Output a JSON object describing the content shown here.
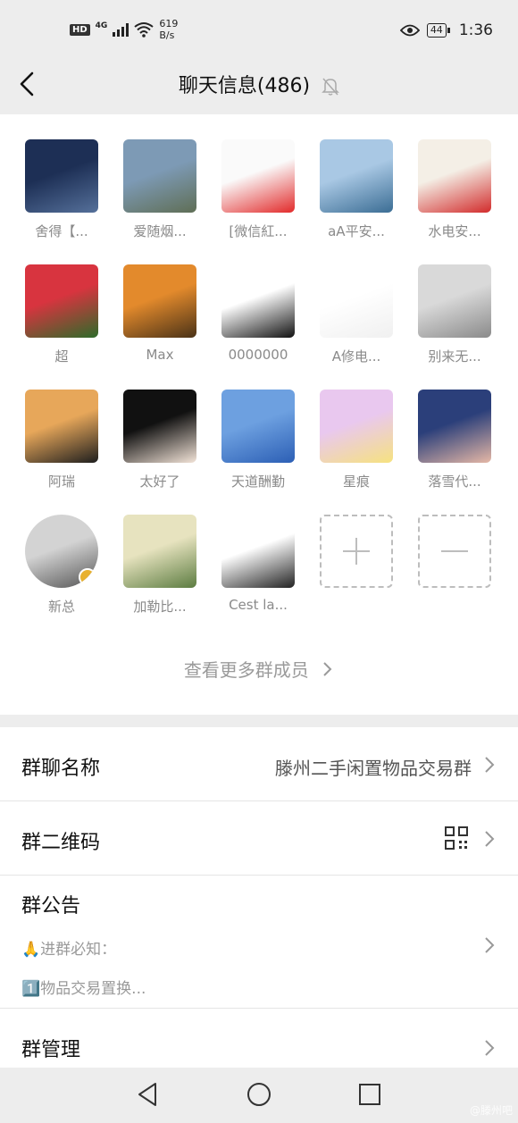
{
  "status_bar": {
    "hd": "HD",
    "network": "4G",
    "speed_value": "619",
    "speed_unit": "B/s",
    "battery": "44",
    "time": "1:36"
  },
  "header": {
    "title": "聊天信息(486)"
  },
  "members": [
    {
      "name": "舍得【...",
      "colors": [
        "#1d2f55",
        "#55709a"
      ]
    },
    {
      "name": "爱随烟...",
      "colors": [
        "#7d9ab5",
        "#5f6e55"
      ]
    },
    {
      "name": "[微信紅...",
      "colors": [
        "#fafafa",
        "#e22a2a"
      ]
    },
    {
      "name": "aA平安...",
      "colors": [
        "#a9c8e4",
        "#3b6d94"
      ]
    },
    {
      "name": "水电安...",
      "colors": [
        "#f4efe6",
        "#d22b2b"
      ]
    },
    {
      "name": "超",
      "colors": [
        "#d8343f",
        "#2d6b2a"
      ]
    },
    {
      "name": "Max",
      "colors": [
        "#e38a2c",
        "#4a3217"
      ]
    },
    {
      "name": "0000000",
      "colors": [
        "#ffffff",
        "#111111"
      ]
    },
    {
      "name": "A修电...",
      "colors": [
        "#ffffff",
        "#f0f0f0"
      ]
    },
    {
      "name": "别来无...",
      "colors": [
        "#d9d9d9",
        "#8a8a8a"
      ]
    },
    {
      "name": "阿瑞",
      "colors": [
        "#e7a75a",
        "#1e1e1e"
      ]
    },
    {
      "name": "太好了",
      "colors": [
        "#111111",
        "#f3e4d8"
      ]
    },
    {
      "name": "天道酬勤",
      "colors": [
        "#6da0e0",
        "#2c5fb5"
      ]
    },
    {
      "name": "星痕",
      "colors": [
        "#e9c8ef",
        "#f6e27f"
      ]
    },
    {
      "name": "落雪代...",
      "colors": [
        "#2b3f7a",
        "#e6b8a6"
      ]
    },
    {
      "name": "新总",
      "colors": [
        "#d3d3d3",
        "#555555"
      ]
    },
    {
      "name": "加勒比...",
      "colors": [
        "#e7e3bf",
        "#5c7c41"
      ]
    },
    {
      "name": "Cest la...",
      "colors": [
        "#ffffff",
        "#222222"
      ]
    }
  ],
  "add_member_icon": "plus-icon",
  "remove_member_icon": "minus-icon",
  "more_members": "查看更多群成员",
  "settings": {
    "group_name_label": "群聊名称",
    "group_name_value": "滕州二手闲置物品交易群",
    "qr_label": "群二维码",
    "notice_label": "群公告",
    "notice_line1": "🙏进群必知：",
    "notice_line2": "1️⃣物品交易置换...",
    "manage_label": "群管理"
  },
  "watermark": "@滕州吧"
}
